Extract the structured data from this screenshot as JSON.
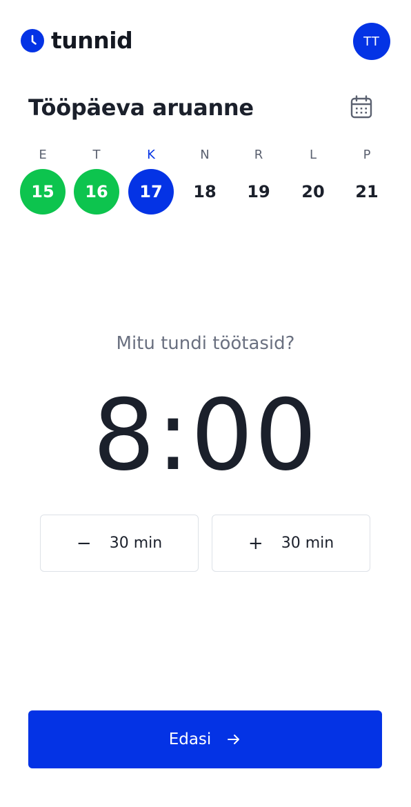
{
  "app": {
    "name": "tunnid",
    "logo_icon": "clock-icon",
    "brand_color": "#0433e5"
  },
  "user": {
    "initials": "TT"
  },
  "header": {
    "title": "Tööpäeva aruanne",
    "calendar_icon": "calendar-icon"
  },
  "week": {
    "days": [
      {
        "letter": "E",
        "date": "15",
        "status": "done"
      },
      {
        "letter": "T",
        "date": "16",
        "status": "done"
      },
      {
        "letter": "K",
        "date": "17",
        "status": "current"
      },
      {
        "letter": "N",
        "date": "18",
        "status": "upcoming"
      },
      {
        "letter": "R",
        "date": "19",
        "status": "upcoming"
      },
      {
        "letter": "L",
        "date": "20",
        "status": "upcoming"
      },
      {
        "letter": "P",
        "date": "21",
        "status": "upcoming"
      }
    ],
    "colors": {
      "done": "#0dc44e",
      "current": "#0433e5"
    }
  },
  "entry": {
    "question": "Mitu tundi töötasid?",
    "hours_value": "8:00"
  },
  "steppers": {
    "decrease": {
      "icon": "minus-icon",
      "symbol": "−",
      "label": "30 min"
    },
    "increase": {
      "icon": "plus-icon",
      "symbol": "+",
      "label": "30 min"
    }
  },
  "footer": {
    "next_label": "Edasi",
    "next_icon": "arrow-right-icon"
  }
}
